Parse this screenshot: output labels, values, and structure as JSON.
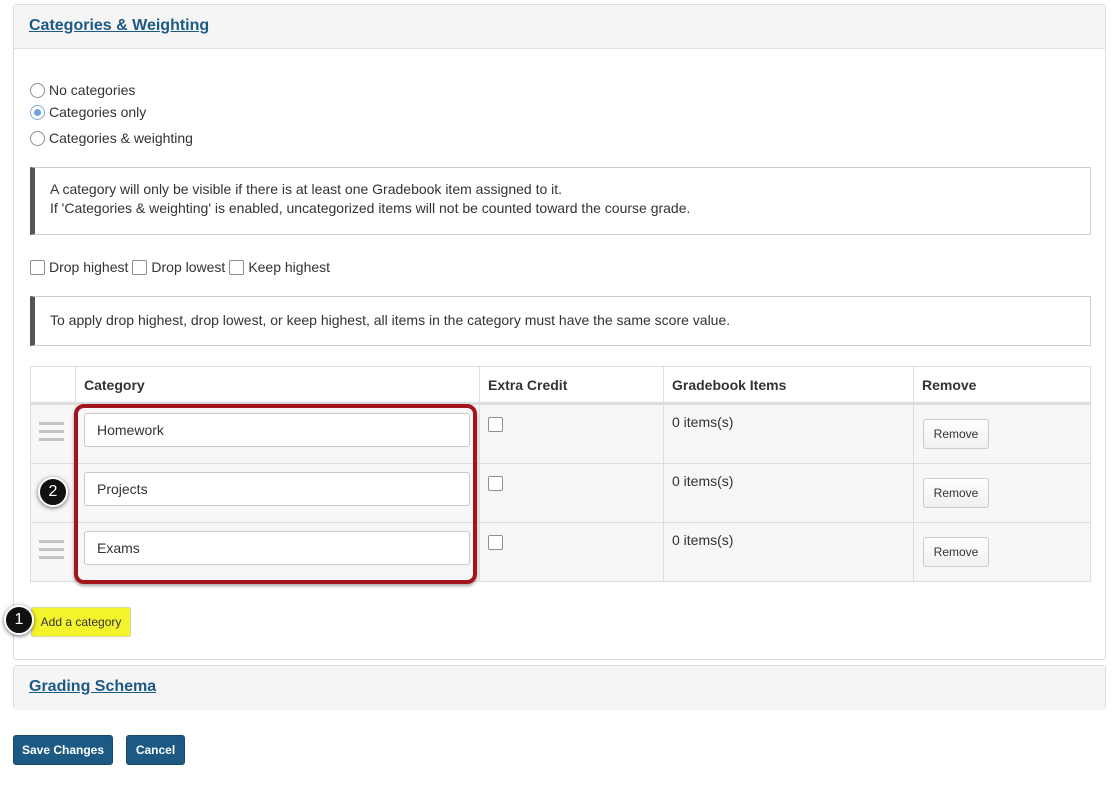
{
  "categories_panel": {
    "title": "Categories & Weighting",
    "radio_options": [
      {
        "label": "No categories",
        "checked": false
      },
      {
        "label": "Categories only",
        "checked": true
      },
      {
        "label": "Categories & weighting",
        "checked": false
      }
    ],
    "info_line_1": "A category will only be visible if there is at least one Gradebook item assigned to it.",
    "info_line_2": "If 'Categories & weighting' is enabled, uncategorized items will not be counted toward the course grade.",
    "drop_options": {
      "drop_highest": "Drop highest",
      "drop_lowest": "Drop lowest",
      "keep_highest": "Keep highest"
    },
    "drop_info": "To apply drop highest, drop lowest, or keep highest, all items in the category must have the same score value.",
    "table": {
      "headers": {
        "category": "Category",
        "extra_credit": "Extra Credit",
        "gradebook_items": "Gradebook Items",
        "remove": "Remove"
      },
      "rows": [
        {
          "category": "Homework",
          "items": "0 items(s)",
          "remove_label": "Remove"
        },
        {
          "category": "Projects",
          "items": "0 items(s)",
          "remove_label": "Remove"
        },
        {
          "category": "Exams",
          "items": "0 items(s)",
          "remove_label": "Remove"
        }
      ]
    },
    "add_category_label": "Add a category"
  },
  "grading_schema_panel": {
    "title": "Grading Schema"
  },
  "callouts": {
    "step_1": "1",
    "step_2": "2"
  },
  "footer": {
    "save_label": "Save Changes",
    "cancel_label": "Cancel"
  },
  "colors": {
    "link_blue": "#1c5a84",
    "highlight_red": "#a3151d",
    "highlight_yellow": "#f4f42c"
  }
}
